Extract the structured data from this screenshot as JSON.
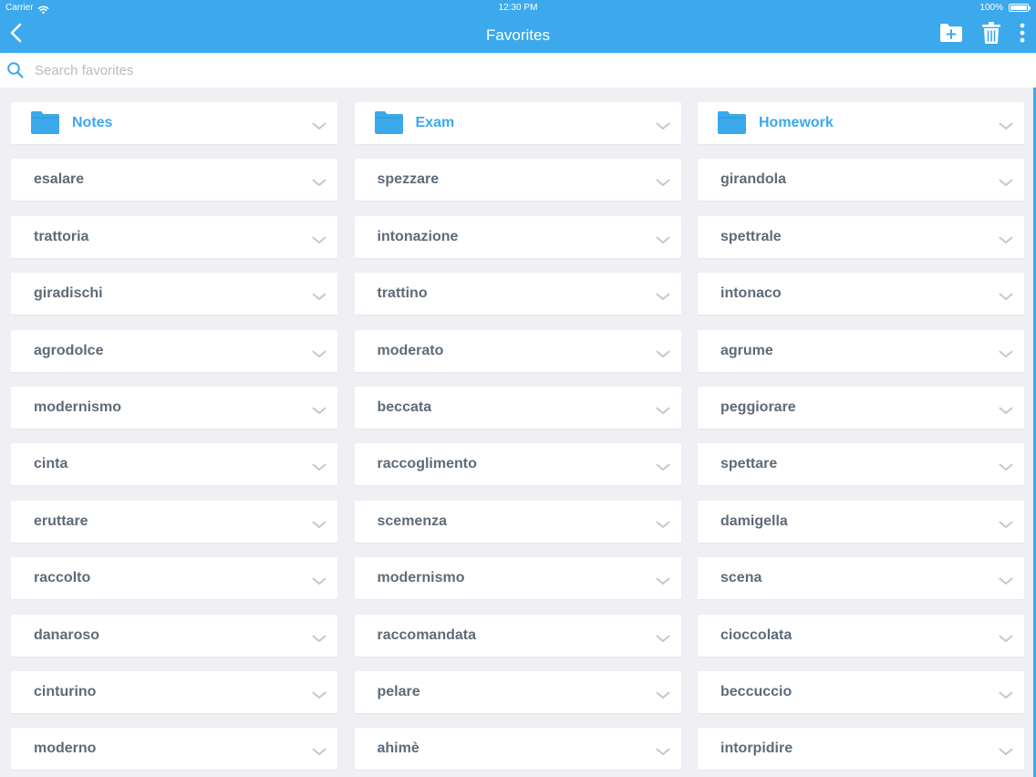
{
  "status_bar": {
    "carrier": "Carrier",
    "time": "12:30 PM",
    "battery": "100%"
  },
  "header": {
    "title": "Favorites",
    "back_icon": "chevron-left-icon",
    "actions": [
      "new-folder-icon",
      "trash-icon",
      "more-vertical-icon"
    ]
  },
  "search": {
    "placeholder": "Search favorites",
    "value": ""
  },
  "colors": {
    "accent": "#3ba9ec",
    "background": "#efeff4",
    "card": "#ffffff",
    "word_text": "#5e6b78",
    "chevron": "#c4c8cc"
  },
  "folders": [
    {
      "label": "Notes"
    },
    {
      "label": "Exam"
    },
    {
      "label": "Homework"
    }
  ],
  "columns": [
    [
      "esalare",
      "trattoria",
      "giradischi",
      "agrodolce",
      "modernismo",
      "cinta",
      "eruttare",
      "raccolto",
      "danaroso",
      "cinturino",
      "moderno"
    ],
    [
      "spezzare",
      "intonazione",
      "trattino",
      "moderato",
      "beccata",
      "raccoglimento",
      "scemenza",
      "modernismo",
      "raccomandata",
      "pelare",
      "ahimè"
    ],
    [
      "girandola",
      "spettrale",
      "intonaco",
      "agrume",
      "peggiorare",
      "spettare",
      "damigella",
      "scena",
      "cioccolata",
      "beccuccio",
      "intorpidire"
    ]
  ]
}
